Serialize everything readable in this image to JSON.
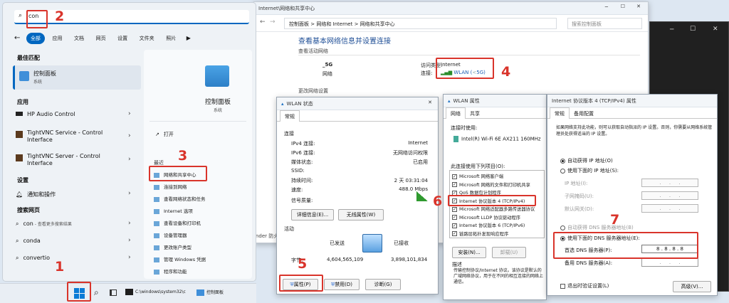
{
  "network_center": {
    "path_title": "Internet\\网络和共享中心",
    "breadcrumb": [
      "控制面板",
      "网络和 Internet",
      "网络和共享中心"
    ],
    "search_placeholder": "搜索控制面板",
    "heading": "查看基本网络信息并设置连接",
    "active_networks_label": "查看活动网络",
    "network_name": "_5G",
    "network_type": "网络",
    "access_type_label": "访问类型:",
    "access_type_value": "Internet",
    "connection_label": "连接:",
    "connection_value": "WLAN (",
    "connection_suffix": "5G)",
    "change_settings": "更改网络设置",
    "side_footer": "nder 防火墙"
  },
  "start_menu": {
    "search_value": "con",
    "filters": [
      "全部",
      "应用",
      "文档",
      "网页",
      "设置",
      "文件夹",
      "照片"
    ],
    "best_match_header": "最佳匹配",
    "best_match": {
      "name": "控制面板",
      "type": "系统"
    },
    "apps_header": "应用",
    "apps": [
      "HP Audio Control",
      "TightVNC Service - Control Interface",
      "TightVNC Server - Control Interface"
    ],
    "settings_header": "设置",
    "settings": [
      "通知和操作"
    ],
    "web_header": "搜索网页",
    "web": [
      {
        "term": "con",
        "suffix": " - 查看更多搜索结果"
      },
      {
        "term": "conda",
        "suffix": ""
      },
      {
        "term": "convertio",
        "suffix": ""
      }
    ],
    "preview_title": "控制面板",
    "preview_type": "系统",
    "open_label": "打开",
    "recent_header": "最近",
    "recent": [
      "网络和共享中心",
      "连接到网络",
      "查看网络状态和任务",
      "Internet 选项",
      "查看设备和打印机",
      "设备管理器",
      "更改账户类型",
      "管理 Windows 凭据",
      "程序和功能"
    ]
  },
  "taskbar": {
    "cmd_label": "C:\\windows\\system32\\c",
    "cp_label": "控制面板"
  },
  "wlan_status": {
    "title": "WLAN 状态",
    "tab": "常规",
    "section_connection": "连接",
    "rows": [
      {
        "k": "IPv4 连接:",
        "v": "Internet"
      },
      {
        "k": "IPv6 连接:",
        "v": "无网络访问权限"
      },
      {
        "k": "媒体状态:",
        "v": "已启用"
      },
      {
        "k": "SSID:",
        "v": ""
      },
      {
        "k": "持续时间:",
        "v": "2 天 03:31:04"
      },
      {
        "k": "速度:",
        "v": "488.0 Mbps"
      }
    ],
    "signal_label": "信号质量:",
    "details_btn": "详细信息(E)...",
    "wireless_btn": "无线属性(W)",
    "activity_label": "活动",
    "sent_label": "已发送",
    "received_label": "已接收",
    "bytes_label": "字节:",
    "bytes_sent": "4,604,565,109",
    "bytes_received": "3,898,101,834",
    "properties_btn": "属性(P)",
    "disable_btn": "禁用(D)",
    "diagnose_btn": "诊断(G)"
  },
  "wlan_props": {
    "title": "WLAN 属性",
    "tabs": [
      "网络",
      "共享"
    ],
    "connect_using_label": "连接时使用:",
    "adapter": "Intel(R) Wi-Fi 6E AX211 160MHz",
    "items_label": "此连接使用下列项目(O):",
    "items": [
      "Microsoft 网络客户端",
      "Microsoft 网络的文件和打印机共享",
      "QoS 数据包计划程序",
      "Internet 协议版本 4 (TCP/IPv4)",
      "Microsoft 网络适配器多路传送器协议",
      "Microsoft LLDP 协议驱动程序",
      "Internet 协议版本 6 (TCP/IPv6)",
      "链路层拓扑发现响应程序"
    ],
    "install_btn": "安装(N)...",
    "uninstall_btn": "卸载(U)",
    "desc_label": "描述",
    "desc_text": "传输控制协议/Internet 协议。该协议是默认的广域网络协议，用于在不同的相互连接的网络上通信。"
  },
  "ipv4": {
    "title": "Internet 协议版本 4 (TCP/IPv4) 属性",
    "tabs": [
      "常规",
      "备用配置"
    ],
    "intro": "如果网络支持此功能，则可以获取自动指派的 IP 设置。否则，你需要从网络系统管理员处获得适当的 IP 设置。",
    "auto_ip": "自动获得 IP 地址(O)",
    "manual_ip": "使用下面的 IP 地址(S):",
    "ip_label": "IP 地址(I):",
    "mask_label": "子网掩码(U):",
    "gateway_label": "默认网关(D):",
    "auto_dns": "自动获得 DNS 服务器地址(B)",
    "manual_dns": "使用下面的 DNS 服务器地址(E):",
    "pref_dns_label": "首选 DNS 服务器(P):",
    "pref_dns": [
      "8",
      "8",
      "8",
      "8"
    ],
    "alt_dns_label": "备用 DNS 服务器(A):",
    "validate": "退出时验证设置(L)",
    "advanced_btn": "高级(V)..."
  },
  "annotations": [
    "1",
    "2",
    "3",
    "4",
    "5",
    "6",
    "7"
  ]
}
